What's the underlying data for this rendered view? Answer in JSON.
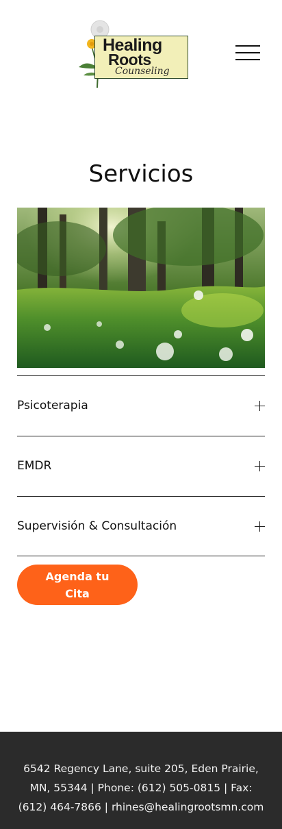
{
  "header": {
    "logo": {
      "line1": "Healing",
      "line2": "Roots",
      "line3": "Counseling"
    },
    "menu_icon": "hamburger-menu-icon"
  },
  "main": {
    "title": "Servicios",
    "hero_image": "forest-meadow-dandelions-photo",
    "accordion": [
      {
        "label": "Psicoterapia",
        "icon": "plus-icon"
      },
      {
        "label": "EMDR",
        "icon": "plus-icon"
      },
      {
        "label": "Supervisión & Consultación",
        "icon": "plus-icon"
      }
    ],
    "cta": {
      "label": "Agenda tu Cita",
      "color": "#fe6219"
    }
  },
  "footer": {
    "text": "6542 Regency Lane, suite 205, Eden Prairie, MN, 55344 | Phone: (612) 505-0815 | Fax: (612) 464-7866 | rhines@healingrootsmn.com"
  },
  "colors": {
    "accent": "#fe6219",
    "footer_bg": "#2b2b2b",
    "logo_box": "#f2efb8"
  }
}
